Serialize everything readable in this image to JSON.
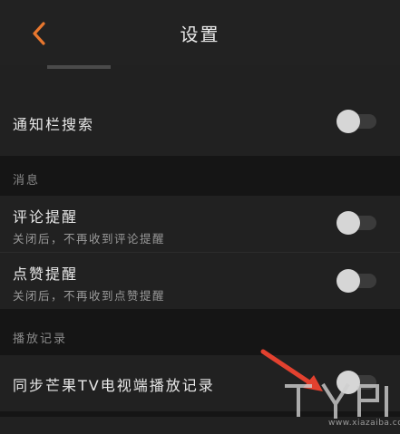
{
  "header": {
    "title": "设置",
    "back_icon": "chevron-left-icon",
    "accent": "#e8772e"
  },
  "rows": {
    "notification_search": {
      "label": "通知栏搜索",
      "toggle_on": false
    },
    "comment_reminder": {
      "label": "评论提醒",
      "sub": "关闭后，不再收到评论提醒",
      "toggle_on": false
    },
    "like_reminder": {
      "label": "点赞提醒",
      "sub": "关闭后，不再收到点赞提醒",
      "toggle_on": false
    },
    "sync_history": {
      "label": "同步芒果TV电视端播放记录",
      "toggle_on": false
    }
  },
  "sections": {
    "messages": "消息",
    "playback": "播放记录"
  },
  "watermark": {
    "text": "www.xiazaiba.com"
  },
  "colors": {
    "background": "#151515",
    "row": "#212121",
    "arrow": "#e2412f"
  }
}
